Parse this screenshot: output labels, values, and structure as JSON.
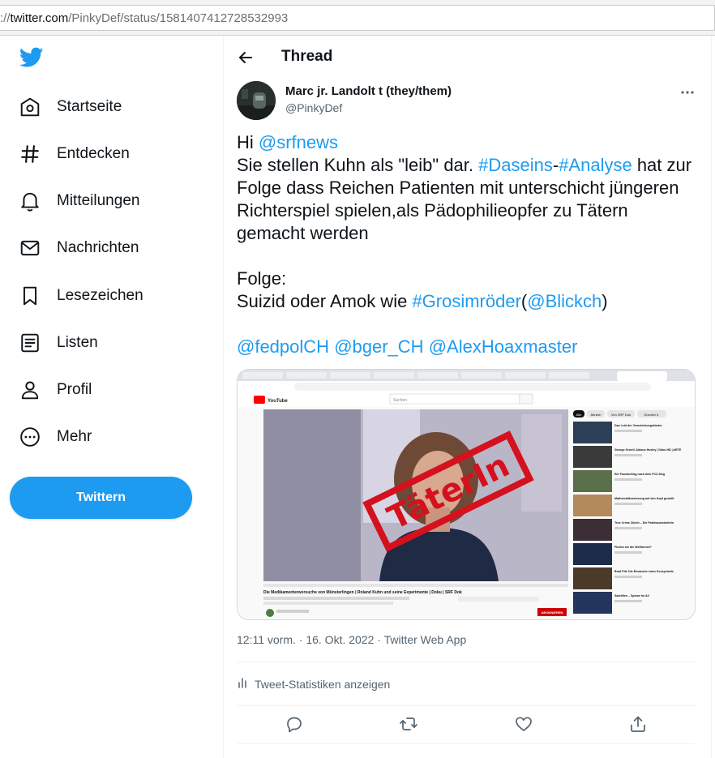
{
  "browser": {
    "url_prefix": "://",
    "url_host": "twitter.com",
    "url_path": "/PinkyDef/status/1581407412728532993"
  },
  "sidebar": {
    "logo_icon": "twitter-bird-icon",
    "items": [
      {
        "label": "Startseite",
        "icon": "home-icon"
      },
      {
        "label": "Entdecken",
        "icon": "hashtag-icon"
      },
      {
        "label": "Mitteilungen",
        "icon": "bell-icon"
      },
      {
        "label": "Nachrichten",
        "icon": "envelope-icon"
      },
      {
        "label": "Lesezeichen",
        "icon": "bookmark-icon"
      },
      {
        "label": "Listen",
        "icon": "list-icon"
      },
      {
        "label": "Profil",
        "icon": "person-icon"
      },
      {
        "label": "Mehr",
        "icon": "more-circle-icon"
      }
    ],
    "tweet_button": "Twittern"
  },
  "header": {
    "title": "Thread"
  },
  "tweet": {
    "author_name": "Marc jr. Landolt t (they/them)",
    "author_handle": "@PinkyDef",
    "text": {
      "l1_a": "Hi ",
      "l1_mention": "@srfnews",
      "l2_a": "Sie stellen Kuhn als \"leib\" dar. ",
      "l2_tag1": "#Daseins",
      "l2_dash": "-",
      "l2_tag2": "#Analyse",
      "l2_b": " hat zur Folge dass Reichen Patienten mit unterschicht jüngeren Richterspiel spielen,als Pädophilieopfer zu Tätern gemacht werden",
      "l3": "Folge:",
      "l4_a": "Suizid oder Amok wie ",
      "l4_tag": "#Grosimröder",
      "l4_open": "(",
      "l4_mention": "@Blickch",
      "l4_close": ")",
      "l5_m1": "@fedpolCH",
      "l5_m2": "@bger_CH",
      "l5_m3": "@AlexHoaxmaster"
    },
    "media": {
      "stamp_text": "TäterIn",
      "video_title": "Die Medikamentenversuche von Münsterlingen | Roland Kuhn und seine Experimente | Doku | SRF Dok",
      "search_placeholder": "Suchen",
      "subscribe": "ABONNIEREN",
      "chips": [
        "Alle",
        "Ähnlich",
        "Von SRF Dok",
        "Kürzlich h."
      ],
      "side_titles": [
        "Das Leid der Verschickungskinder",
        "George Orwell, Aldous Huxley | Doku HD | ARTE",
        "Ein Faustschlag nach dem FCZ-Sieg",
        "Mathematikvorlesung auf den Kopf gestellt",
        "True Crime Zürich – Die Parkhausmörderin",
        "Finden wir die Weltformel?",
        "Brad Pitt: Die Revanche eines Sexsymbols",
        "Satelliten – Spione im All"
      ]
    },
    "timestamp": "12:11 vorm. · 16. Okt. 2022 · Twitter Web App",
    "stats_label": "Tweet-Statistiken anzeigen",
    "actions": [
      "reply-icon",
      "retweet-icon",
      "like-icon",
      "share-icon"
    ]
  },
  "colors": {
    "accent": "#1d9bf0",
    "text": "#0f1419",
    "muted": "#536471",
    "stamp_red": "#d4111d"
  }
}
